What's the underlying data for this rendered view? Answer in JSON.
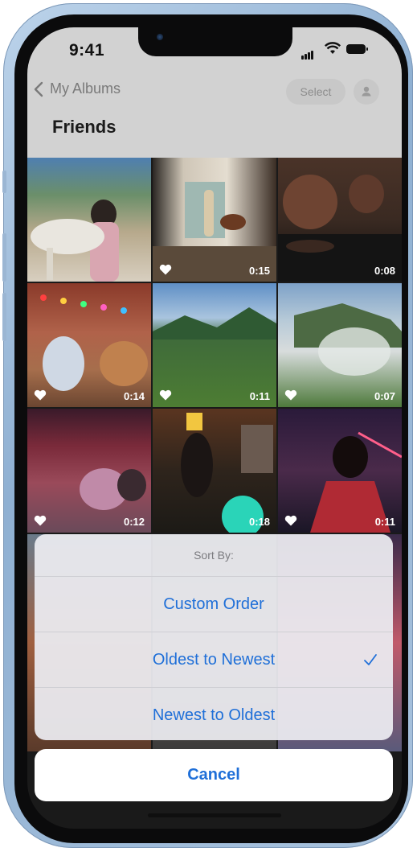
{
  "status_bar": {
    "time": "9:41"
  },
  "nav": {
    "back_label": "My Albums",
    "select_label": "Select",
    "title": "Friends"
  },
  "photos": [
    {
      "duration": ""
    },
    {
      "duration": "0:15"
    },
    {
      "duration": "0:08"
    },
    {
      "duration": "0:14"
    },
    {
      "duration": "0:11"
    },
    {
      "duration": "0:07"
    },
    {
      "duration": "0:12"
    },
    {
      "duration": "0:18"
    },
    {
      "duration": "0:11"
    }
  ],
  "sort_sheet": {
    "title": "Sort By:",
    "options": [
      {
        "label": "Custom Order",
        "selected": false
      },
      {
        "label": "Oldest to Newest",
        "selected": true
      },
      {
        "label": "Newest to Oldest",
        "selected": false
      }
    ],
    "cancel_label": "Cancel"
  },
  "colors": {
    "accent": "#1f6fd8"
  }
}
